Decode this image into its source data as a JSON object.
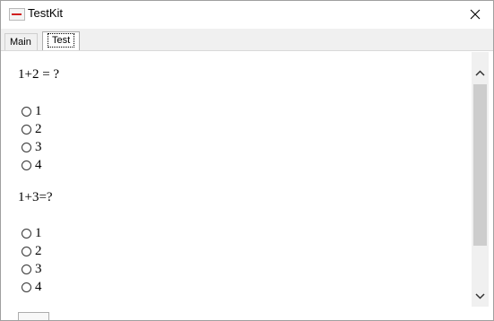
{
  "window": {
    "title": "TestKit"
  },
  "tabs": [
    {
      "label": "Main",
      "selected": false
    },
    {
      "label": "Test",
      "selected": true
    }
  ],
  "questions": [
    {
      "text": "1+2 = ?",
      "options": [
        "1",
        "2",
        "3",
        "4"
      ]
    },
    {
      "text": "1+3=?",
      "options": [
        "1",
        "2",
        "3",
        "4"
      ]
    }
  ],
  "icons": {
    "app": "app-icon",
    "close": "close-icon",
    "scroll_up": "chevron-up-icon",
    "scroll_down": "chevron-down-icon"
  },
  "colors": {
    "tabstrip_bg": "#f0f0f0",
    "scroll_thumb": "#cdcdcd",
    "app_icon_accent": "#d02020"
  }
}
